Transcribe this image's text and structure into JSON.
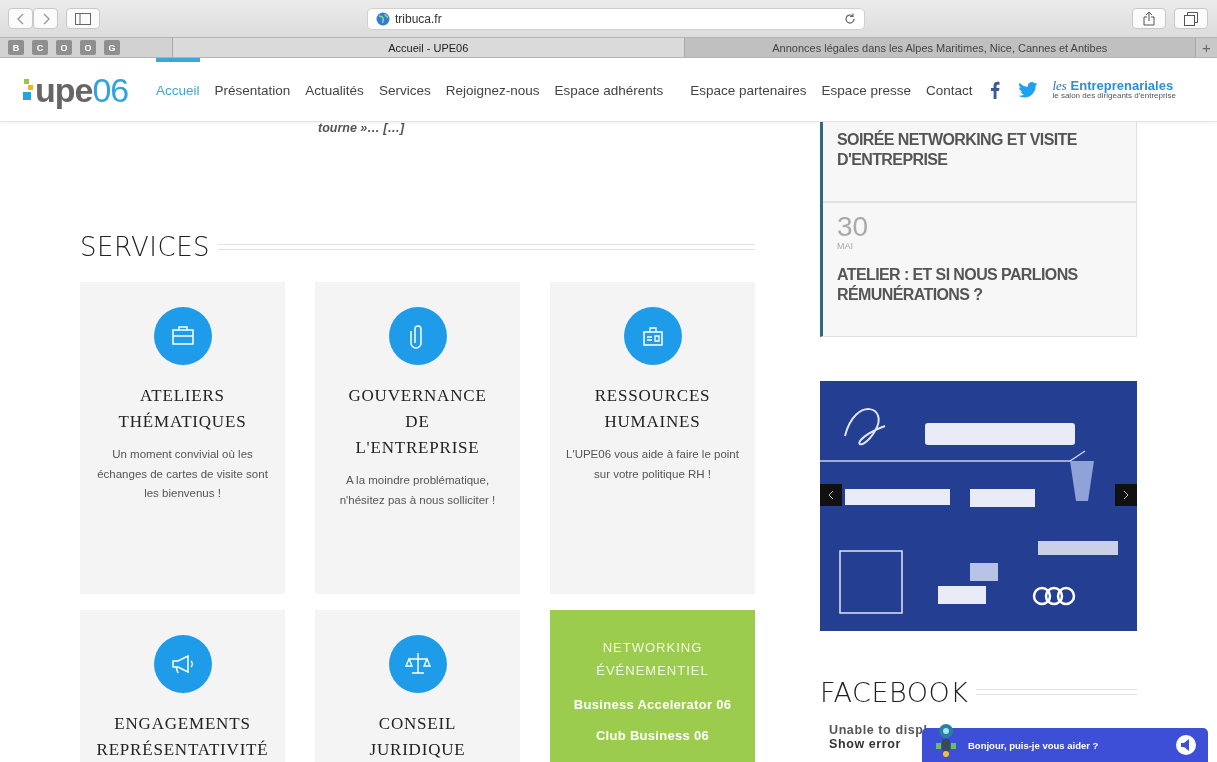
{
  "browser": {
    "url": "tribuca.fr",
    "bookmarks": [
      "B",
      "C",
      "O",
      "O",
      "G"
    ],
    "tabs": [
      {
        "title": "Accueil - UPE06",
        "selected": true
      },
      {
        "title": "Annonces légales dans les Alpes Maritimes, Nice, Cannes et Antibes",
        "selected": false
      }
    ],
    "new_tab": "+"
  },
  "site": {
    "logo": {
      "name": "upe",
      "number": "06"
    },
    "nav": [
      {
        "label": "Accueil",
        "selected": true
      },
      {
        "label": "Présentation",
        "selected": false
      },
      {
        "label": "Actualités",
        "selected": false
      },
      {
        "label": "Services",
        "selected": false
      },
      {
        "label": "Rejoignez-nous",
        "selected": false
      },
      {
        "label": "Espace adhérents",
        "selected": false
      },
      {
        "label": "Espace partenaires",
        "selected": false
      },
      {
        "label": "Espace presse",
        "selected": false
      },
      {
        "label": "Contact",
        "selected": false
      }
    ],
    "partner_logo": {
      "prefix": "les",
      "name": "Entreprenariales",
      "tagline": "le salon des dirigeants d'entreprise"
    }
  },
  "main": {
    "excerpt_tail": "tourne »… […]",
    "services": {
      "heading": "SERVICES",
      "cards": [
        {
          "kind": "service",
          "title_lines": [
            "ATELIERS",
            "THÉMATIQUES"
          ],
          "text": "Un moment convivial où les échanges de cartes de visite sont les bienvenus !"
        },
        {
          "kind": "service",
          "title_lines": [
            "GOUVERNANCE",
            "DE",
            "L'ENTREPRISE"
          ],
          "text": "A la moindre problématique, n'hésitez pas à nous solliciter !"
        },
        {
          "kind": "service",
          "title_lines": [
            "RESSOURCES",
            "HUMAINES"
          ],
          "text": "L'UPE06 vous aide à faire le point sur votre politique RH !"
        },
        {
          "kind": "service",
          "title_lines": [
            "ENGAGEMENTS",
            "REPRÉSENTATIVITÉ"
          ]
        },
        {
          "kind": "service",
          "title_lines": [
            "CONSEIL",
            "JURIDIQUE"
          ]
        },
        {
          "kind": "links",
          "title_lines": [
            "NETWORKING",
            "ÉVÉNEMENTIEL"
          ],
          "links": [
            "Business Accelerator 06",
            "Club Business 06"
          ]
        }
      ]
    }
  },
  "sidebar": {
    "events": [
      {
        "title": "SOIRÉE NETWORKING ET VISITE D'ENTREPRISE"
      },
      {
        "day": "30",
        "month": "MAI",
        "title": "ATELIER : ET SI NOUS PARLIONS RÉMUNÉRATIONS ?"
      }
    ],
    "facebook": {
      "heading": "FACEBOOK",
      "message": "Unable to displ",
      "link": "Show error"
    }
  },
  "chat": {
    "message": "Bonjour, puis-je vous aider ?"
  }
}
